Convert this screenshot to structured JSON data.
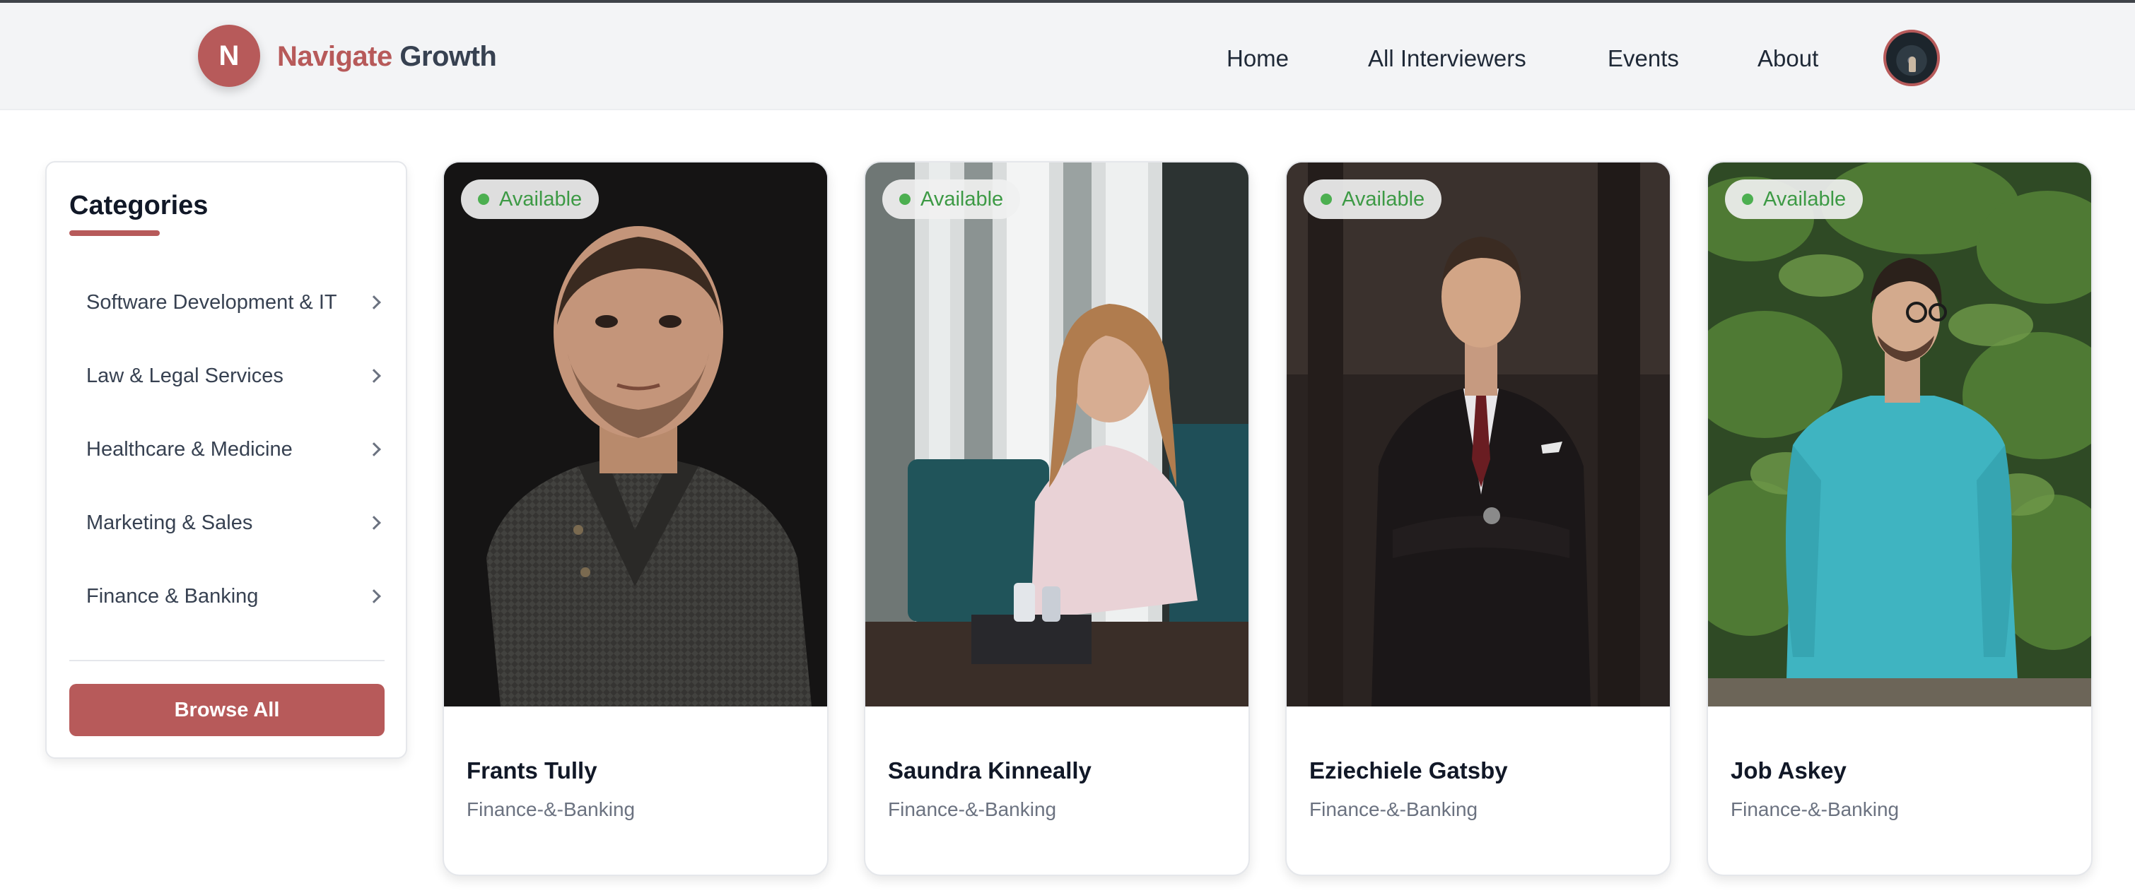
{
  "brand": {
    "logo_letter": "N",
    "name_part1": "Navigate",
    "name_part2": "Growth",
    "accent_color": "#b75a5a"
  },
  "nav": {
    "links": [
      "Home",
      "All Interviewers",
      "Events",
      "About"
    ]
  },
  "sidebar": {
    "title": "Categories",
    "items": [
      "Software Development & IT",
      "Law & Legal Services",
      "Healthcare & Medicine",
      "Marketing & Sales",
      "Finance & Banking"
    ],
    "browse_label": "Browse All"
  },
  "cards": [
    {
      "name": "Frants Tully",
      "category": "Finance-&-Banking",
      "status": "Available"
    },
    {
      "name": "Saundra Kinneally",
      "category": "Finance-&-Banking",
      "status": "Available"
    },
    {
      "name": "Eziechiele Gatsby",
      "category": "Finance-&-Banking",
      "status": "Available"
    },
    {
      "name": "Job Askey",
      "category": "Finance-&-Banking",
      "status": "Available"
    }
  ],
  "status_color": "#4caf50"
}
